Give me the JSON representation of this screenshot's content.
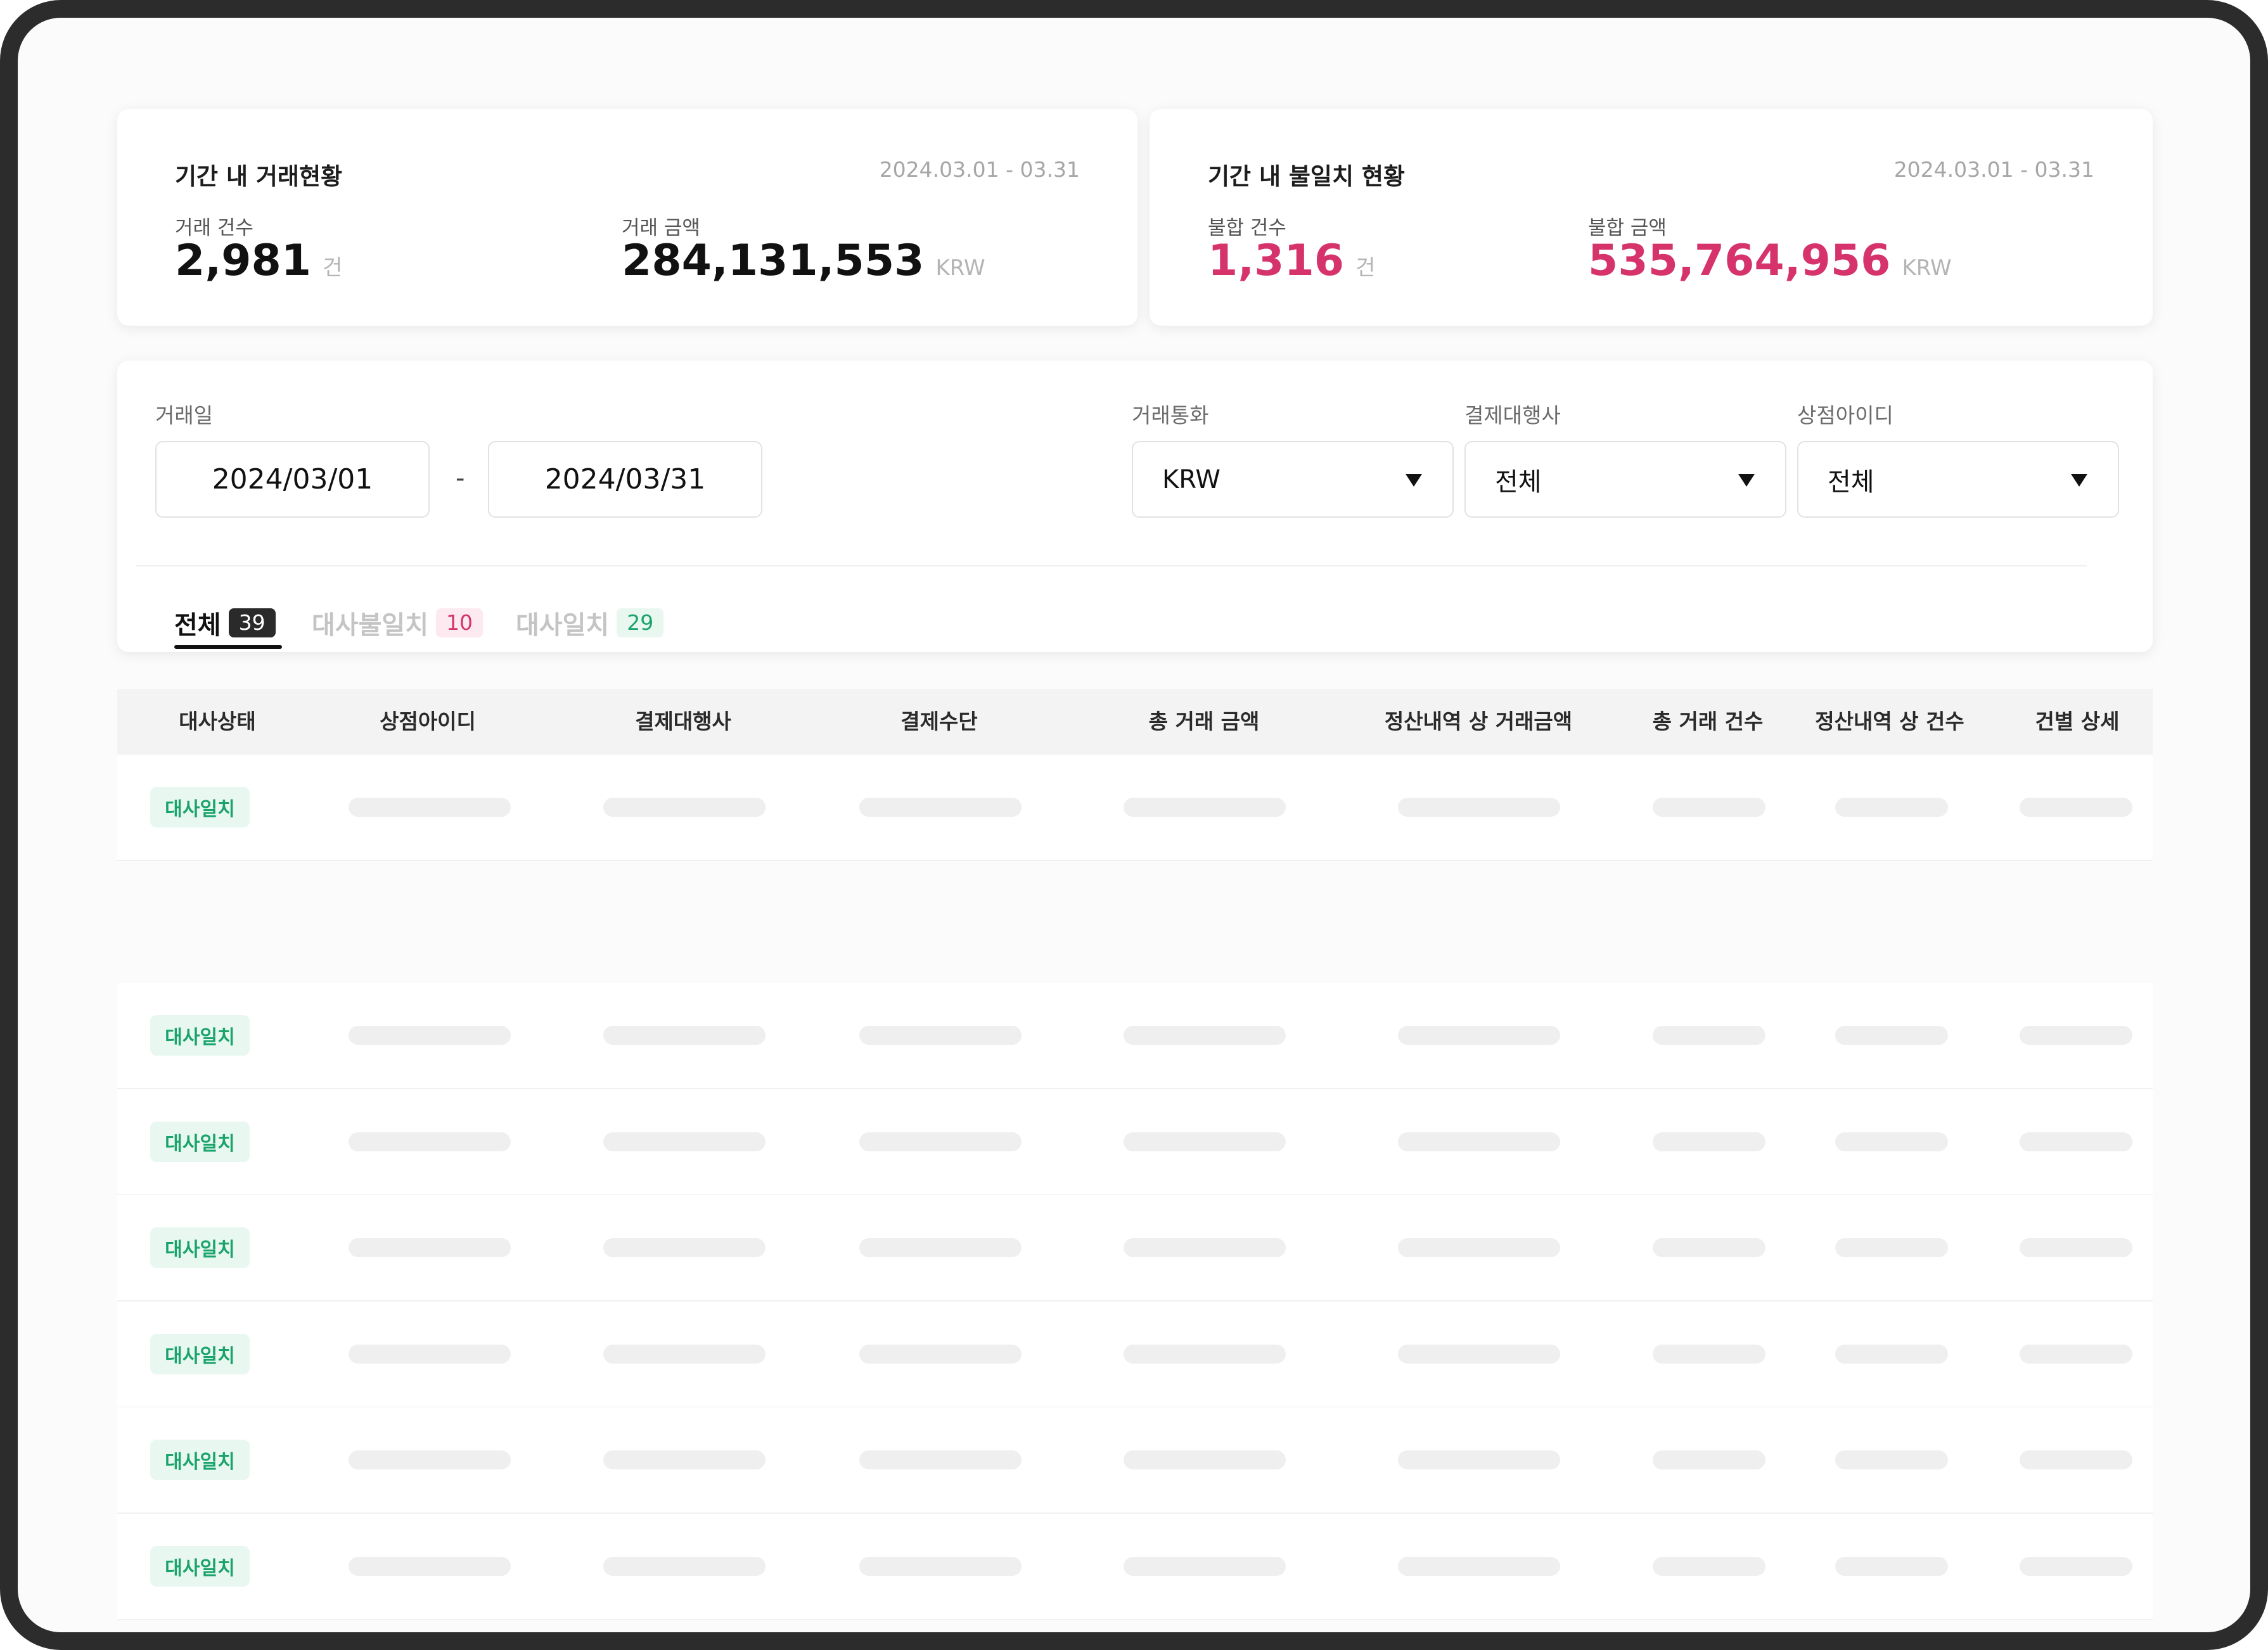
{
  "summary": {
    "transactions": {
      "title": "기간 내 거래현황",
      "period": "2024.03.01 - 03.31",
      "count_label": "거래 건수",
      "count_value": "2,981",
      "count_unit": "건",
      "amount_label": "거래 금액",
      "amount_value": "284,131,553",
      "amount_unit": "KRW"
    },
    "mismatch": {
      "title": "기간 내 불일치 현황",
      "period": "2024.03.01 - 03.31",
      "count_label": "불합 건수",
      "count_value": "1,316",
      "count_unit": "건",
      "amount_label": "불합 금액",
      "amount_value": "535,764,956",
      "amount_unit": "KRW",
      "accent_color": "#d6336c"
    }
  },
  "filters": {
    "date_label": "거래일",
    "date_from": "2024/03/01",
    "date_separator": "-",
    "date_to": "2024/03/31",
    "currency_label": "거래통화",
    "currency_value": "KRW",
    "pg_label": "결제대행사",
    "pg_value": "전체",
    "merchant_label": "상점아이디",
    "merchant_value": "전체",
    "dropdown_icon": "caret-down-icon"
  },
  "tabs": [
    {
      "label": "전체",
      "count": "39",
      "active": true
    },
    {
      "label": "대사불일치",
      "count": "10",
      "active": false,
      "count_color": "#d6336c"
    },
    {
      "label": "대사일치",
      "count": "29",
      "active": false,
      "count_color": "#1aa36b"
    }
  ],
  "table": {
    "columns": [
      "대사상태",
      "상점아이디",
      "결제대행사",
      "결제수단",
      "총 거래 금액",
      "정산내역 상 거래금액",
      "총 거래 건수",
      "정산내역 상 건수",
      "건별 상세"
    ],
    "rows": [
      {
        "status": "대사일치"
      },
      {
        "status": "대사일치"
      },
      {
        "status": "대사일치"
      },
      {
        "status": "대사일치"
      },
      {
        "status": "대사일치"
      },
      {
        "status": "대사일치"
      },
      {
        "status": "대사일치"
      }
    ],
    "status_color": "#1aa36b"
  }
}
